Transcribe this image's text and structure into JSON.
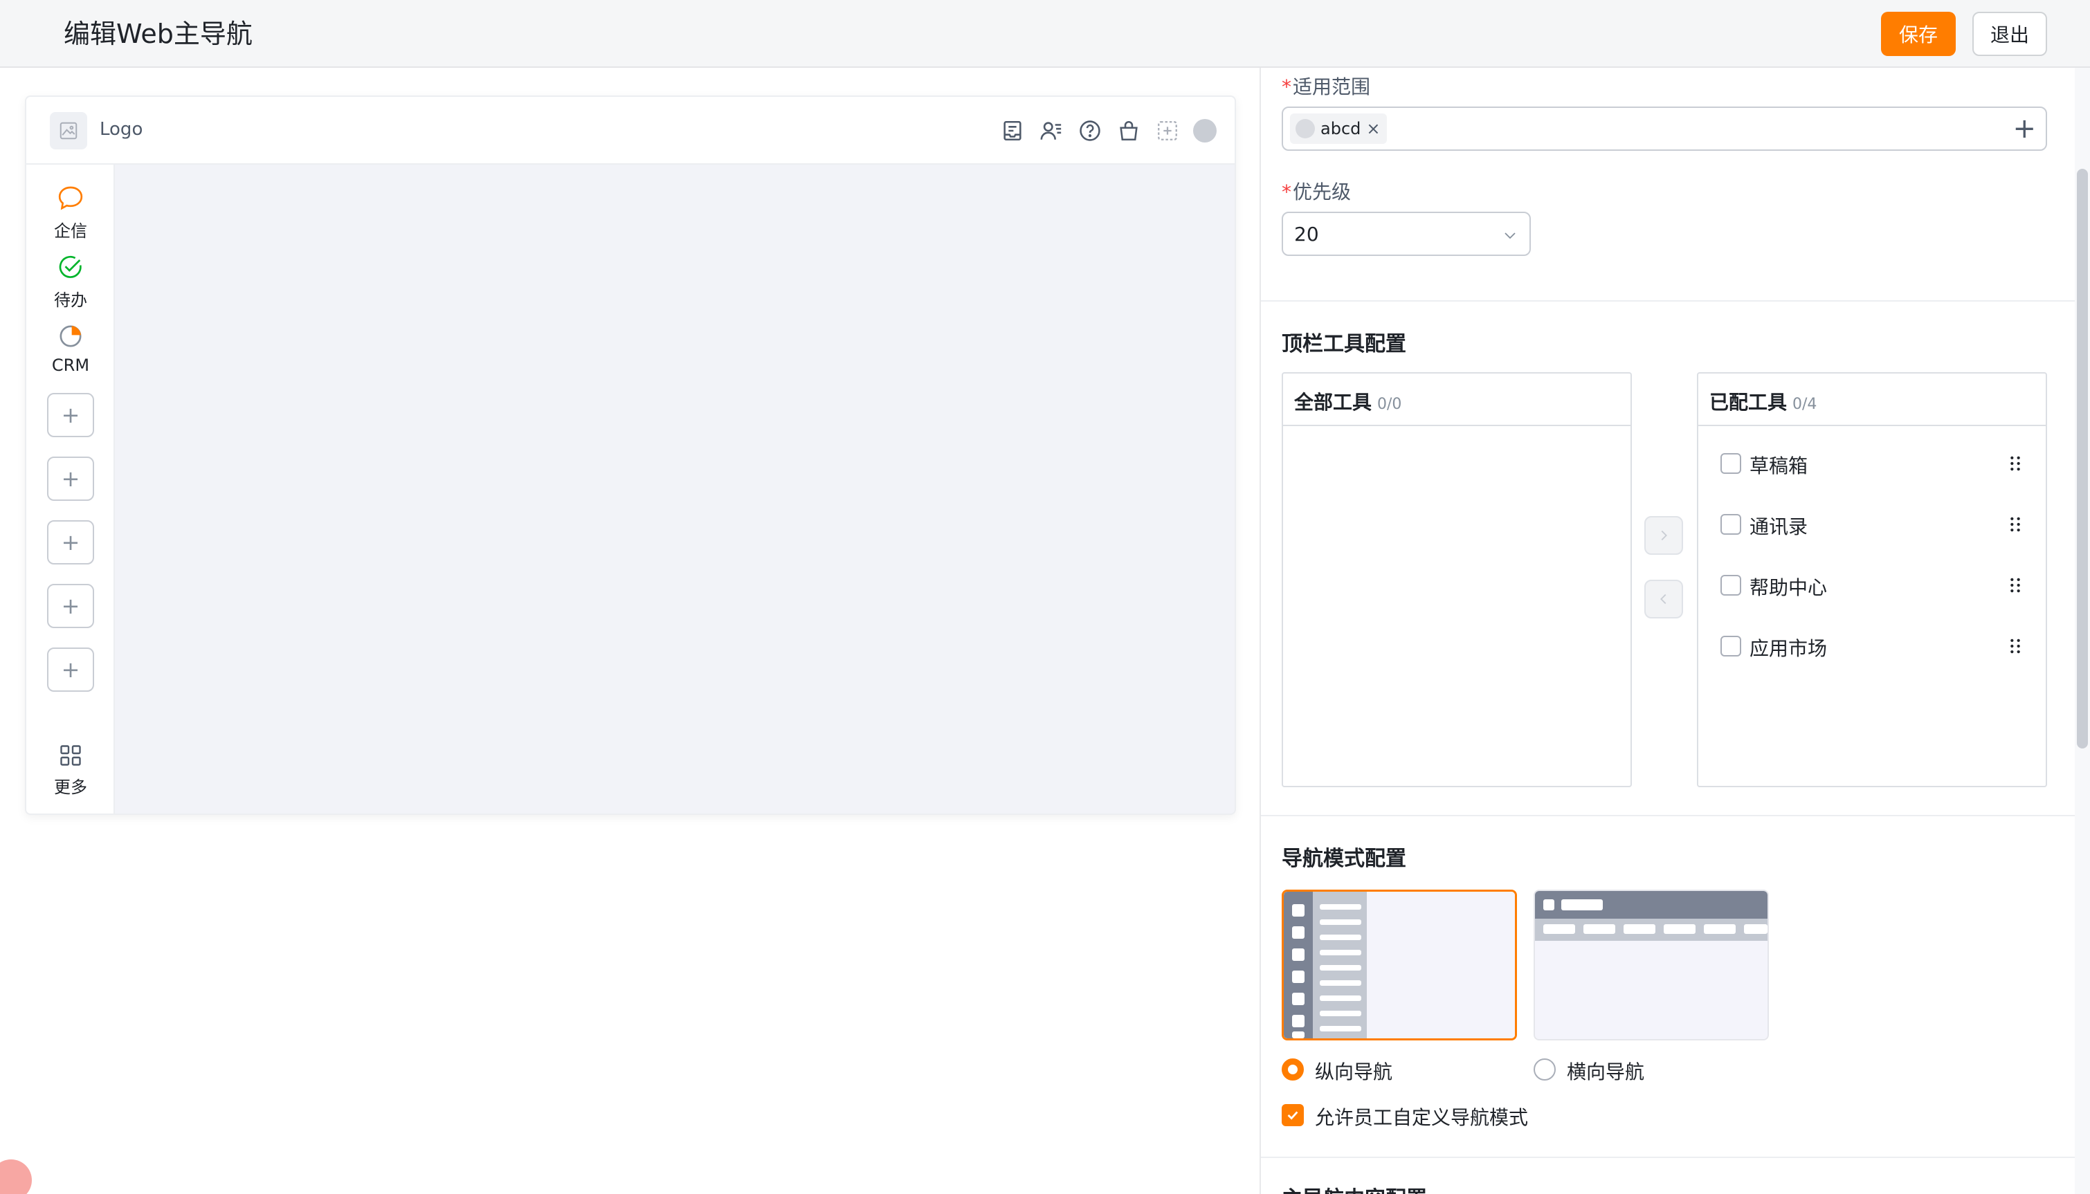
{
  "header": {
    "title": "编辑Web主导航",
    "save_label": "保存",
    "exit_label": "退出"
  },
  "preview": {
    "logo_label": "Logo",
    "top_icons": [
      "drafts-icon",
      "contacts-icon",
      "help-icon",
      "app-store-icon",
      "add-dashed-icon",
      "avatar"
    ],
    "side_apps": [
      {
        "label": "企信",
        "icon": "chat-bubble-icon",
        "color": "#ff7d00"
      },
      {
        "label": "待办",
        "icon": "check-circle-icon",
        "color": "#00b42a"
      },
      {
        "label": "CRM",
        "icon": "pie-chart-icon",
        "color": "#ff7d00"
      }
    ],
    "add_slot_symbol": "+",
    "more_label": "更多"
  },
  "form": {
    "scope": {
      "label": "适用范围",
      "required_mark": "*",
      "tags": [
        "abcd"
      ],
      "tag_close": "×",
      "add_symbol": "+"
    },
    "priority": {
      "label": "优先级",
      "required_mark": "*",
      "value": "20"
    }
  },
  "toolbar_config": {
    "title": "顶栏工具配置",
    "all_tools": {
      "title": "全部工具",
      "count": "0/0",
      "items": []
    },
    "configured_tools": {
      "title": "已配工具",
      "count": "0/4",
      "items": [
        "草稿箱",
        "通讯录",
        "帮助中心",
        "应用市场"
      ]
    }
  },
  "nav_mode": {
    "title": "导航模式配置",
    "options": [
      {
        "label": "纵向导航",
        "selected": true
      },
      {
        "label": "横向导航",
        "selected": false
      }
    ],
    "allow_custom_label": "允许员工自定义导航模式",
    "allow_custom_checked": true
  },
  "next_section_title": "主导航内容配置",
  "colors": {
    "accent": "#ff7d00",
    "required": "#f53f3f",
    "border": "#c9cdd4"
  }
}
